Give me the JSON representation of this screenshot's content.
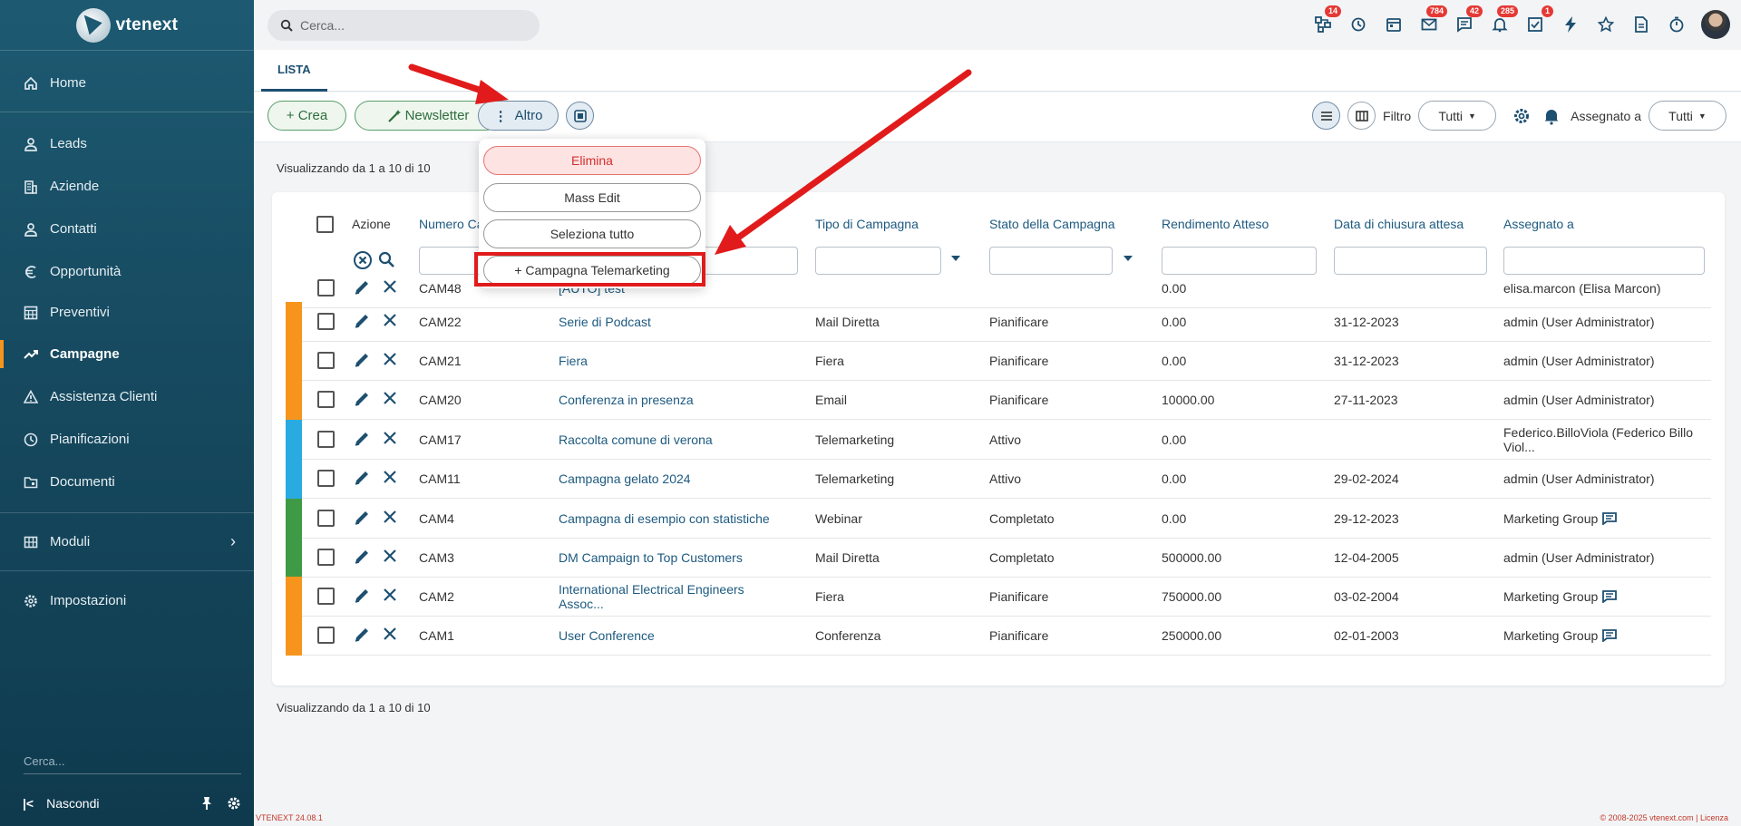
{
  "app": {
    "logo_text": "vtenext",
    "version": "VTENEXT 24.08.1",
    "copyright": "© 2008-2025 vtenext.com | Licenza"
  },
  "sidebar": {
    "items": [
      {
        "label": "Home",
        "icon": "home-icon"
      },
      {
        "label": "Leads",
        "icon": "person-icon"
      },
      {
        "label": "Aziende",
        "icon": "building-icon"
      },
      {
        "label": "Contatti",
        "icon": "person-icon"
      },
      {
        "label": "Opportunità",
        "icon": "euro-icon"
      },
      {
        "label": "Preventivi",
        "icon": "calculator-icon"
      },
      {
        "label": "Campagne",
        "icon": "trending-icon",
        "active": true
      },
      {
        "label": "Assistenza Clienti",
        "icon": "warning-icon"
      },
      {
        "label": "Pianificazioni",
        "icon": "clock-icon"
      },
      {
        "label": "Documenti",
        "icon": "folder-icon"
      },
      {
        "label": "Moduli",
        "icon": "grid-icon"
      },
      {
        "label": "Impostazioni",
        "icon": "gear-icon"
      }
    ],
    "search_placeholder": "Cerca...",
    "hide_label": "Nascondi"
  },
  "topbar": {
    "search_placeholder": "Cerca...",
    "badges": {
      "processes": "14",
      "mail": "784",
      "chat": "42",
      "notifications": "285",
      "tasks": "1"
    }
  },
  "tabs": {
    "list": "LISTA"
  },
  "toolbar": {
    "create": "+ Crea",
    "newsletter": "Newsletter",
    "more": "Altro",
    "filter_label": "Filtro",
    "filter_value": "Tutti",
    "assigned_label": "Assegnato a",
    "assigned_value": "Tutti"
  },
  "menu": {
    "delete": "Elimina",
    "mass_edit": "Mass Edit",
    "select_all": "Seleziona tutto",
    "telemarketing": "+ Campagna Telemarketing"
  },
  "list": {
    "info": "Visualizzando da 1 a 10 di 10",
    "headers": {
      "action": "Azione",
      "number": "Numero Ca",
      "type": "Tipo di Campagna",
      "status": "Stato della Campagna",
      "revenue": "Rendimento Atteso",
      "close_date": "Data di chiusura attesa",
      "assigned": "Assegnato a"
    },
    "rows": [
      {
        "num": "CAM48",
        "name": "[AUTO] test",
        "type": "",
        "status": "",
        "revenue": "0.00",
        "date": "",
        "assigned": "elisa.marcon (Elisa Marcon)",
        "color": ""
      },
      {
        "num": "CAM22",
        "name": "Serie di Podcast",
        "type": "Mail Diretta",
        "status": "Pianificare",
        "revenue": "0.00",
        "date": "31-12-2023",
        "assigned": "admin (User Administrator)",
        "color": "#f7941d"
      },
      {
        "num": "CAM21",
        "name": "Fiera",
        "type": "Fiera",
        "status": "Pianificare",
        "revenue": "0.00",
        "date": "31-12-2023",
        "assigned": "admin (User Administrator)",
        "color": "#f7941d"
      },
      {
        "num": "CAM20",
        "name": "Conferenza in presenza",
        "type": "Email",
        "status": "Pianificare",
        "revenue": "10000.00",
        "date": "27-11-2023",
        "assigned": "admin (User Administrator)",
        "color": "#f7941d"
      },
      {
        "num": "CAM17",
        "name": "Raccolta comune di verona",
        "type": "Telemarketing",
        "status": "Attivo",
        "revenue": "0.00",
        "date": "",
        "assigned": "Federico.BilloViola (Federico Billo Viol...",
        "color": "#29aae1"
      },
      {
        "num": "CAM11",
        "name": "Campagna gelato 2024",
        "type": "Telemarketing",
        "status": "Attivo",
        "revenue": "0.00",
        "date": "29-02-2024",
        "assigned": "admin (User Administrator)",
        "color": "#29aae1"
      },
      {
        "num": "CAM4",
        "name": "Campagna di esempio con statistiche",
        "type": "Webinar",
        "status": "Completato",
        "revenue": "0.00",
        "date": "29-12-2023",
        "assigned": "Marketing Group",
        "color": "#3f9a45",
        "chat": true
      },
      {
        "num": "CAM3",
        "name": "DM Campaign to Top Customers",
        "type": "Mail Diretta",
        "status": "Completato",
        "revenue": "500000.00",
        "date": "12-04-2005",
        "assigned": "admin (User Administrator)",
        "color": "#3f9a45"
      },
      {
        "num": "CAM2",
        "name": "International Electrical Engineers Assoc...",
        "type": "Fiera",
        "status": "Pianificare",
        "revenue": "750000.00",
        "date": "03-02-2004",
        "assigned": "Marketing Group",
        "color": "#f7941d",
        "chat": true
      },
      {
        "num": "CAM1",
        "name": "User Conference",
        "type": "Conferenza",
        "status": "Pianificare",
        "revenue": "250000.00",
        "date": "02-01-2003",
        "assigned": "Marketing Group",
        "color": "#f7941d",
        "chat": true
      }
    ]
  }
}
